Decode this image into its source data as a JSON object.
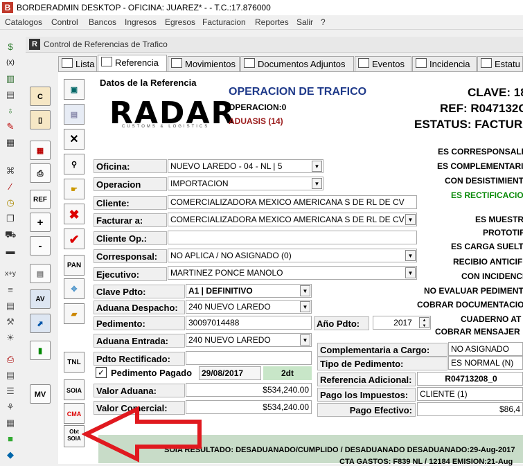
{
  "window": {
    "title": "BORDERADMIN DESKTOP - OFICINA: JUAREZ* -  - T.C.:17.876000"
  },
  "menu": [
    "Catalogos",
    "Control",
    "Bancos",
    "Ingresos",
    "Egresos",
    "Facturacion",
    "Reportes",
    "Salir",
    "?"
  ],
  "child": {
    "title": "Control de Referencias de Trafico"
  },
  "tabs": [
    "Lista",
    "Referencia",
    "Movimientos",
    "Documentos Adjuntos",
    "Eventos",
    "Incidencia",
    "Estatu"
  ],
  "side_buttons": [
    "C",
    "REF",
    "+",
    "-",
    "PAN",
    "AV",
    "MV"
  ],
  "vtool": [
    "TNL",
    "SOIA",
    "CMA",
    "Obt SOIA"
  ],
  "logo": {
    "name": "RADAR",
    "tagline": "CUSTOMS & LOGISTICS"
  },
  "header": {
    "section": "Datos de la Referencia",
    "op_title": "OPERACION DE TRAFICO",
    "op_num": "OPERACION:0",
    "aduasis": "ADUASIS (14)",
    "clave": "CLAVE: 18",
    "ref": "REF: R047132O",
    "estatus": "ESTATUS: FACTURA"
  },
  "form": {
    "oficina": {
      "label": "Oficina:",
      "value": "NUEVO LAREDO - 04 - NL | 5"
    },
    "operacion": {
      "label": "Operacion",
      "value": "IMPORTACION"
    },
    "cliente": {
      "label": "Cliente:",
      "value": "COMERCIALIZADORA MEXICO AMERICANA S DE RL DE CV"
    },
    "facturar": {
      "label": "Facturar a:",
      "value": "COMERCIALIZADORA MEXICO AMERICANA S DE RL DE CV (1"
    },
    "cliente_op": {
      "label": "Cliente Op.:",
      "value": ""
    },
    "corresponsal": {
      "label": "Corresponsal:",
      "value": "NO APLICA / NO ASIGNADO (0)"
    },
    "ejecutivo": {
      "label": "Ejecutivo:",
      "value": "MARTINEZ PONCE MANOLO"
    },
    "clave_pdto": {
      "label": "Clave Pdto:",
      "value": "A1 | DEFINITIVO"
    },
    "aduana_despacho": {
      "label": "Aduana Despacho:",
      "value": "240 NUEVO LAREDO"
    },
    "pedimento": {
      "label": "Pedimento:",
      "value": "30097014488"
    },
    "anio_pdto": {
      "label": "Año Pdto:",
      "value": "2017"
    },
    "aduana_entrada": {
      "label": "Aduana Entrada:",
      "value": "240 NUEVO LAREDO"
    },
    "pdto_rect": {
      "label": "Pdto Rectificado:",
      "value": ""
    },
    "pedimento_pagado": {
      "label": "Pedimento Pagado",
      "date": "29/08/2017",
      "dt": "2dt",
      "checked": true
    },
    "valor_aduana": {
      "label": "Valor Aduana:",
      "value": "$534,240.00"
    },
    "valor_comercial": {
      "label": "Valor Comercial:",
      "value": "$534,240.00"
    },
    "complementaria": {
      "label": "Complementaria a Cargo:",
      "value": "NO ASIGNADO"
    },
    "tipo_pedimento": {
      "label": "Tipo de Pedimento:",
      "value": "ES NORMAL (N)"
    },
    "ref_adicional": {
      "label": "Referencia Adicional:",
      "value": "R04713208_0"
    },
    "pago_impuestos": {
      "label": "Pago los Impuestos:",
      "value": "CLIENTE (1)"
    },
    "pago_efectivo": {
      "label": "Pago Efectivo:",
      "value": "$86,4"
    }
  },
  "flags": [
    "ES CORRESPONSALI",
    "ES COMPLEMENTARI",
    "CON DESISTIMIENT",
    "ES RECTIFICACIO",
    "ES MUESTR",
    "PROTOTIF",
    "ES CARGA SUELT",
    "RECIBIO ANTICIF",
    "CON INCIDENCI",
    "NO EVALUAR PEDIMENT",
    "COBRAR DOCUMENTACIO",
    "CUADERNO AT",
    "COBRAR MENSAJER"
  ],
  "status_bar": {
    "soia": "SOIA RESULTADO: DESADUANADO/CUMPLIDO / DESADUANADO  DESADUANADO:29-Aug-2017",
    "cta": "CTA GASTOS: F839 NL / 12184 EMISION:21-Aug"
  },
  "colors": {
    "accent": "#1f3a8a",
    "red": "#9b1c1c",
    "green": "#0a8a0a",
    "arrow": "#e0191f"
  }
}
